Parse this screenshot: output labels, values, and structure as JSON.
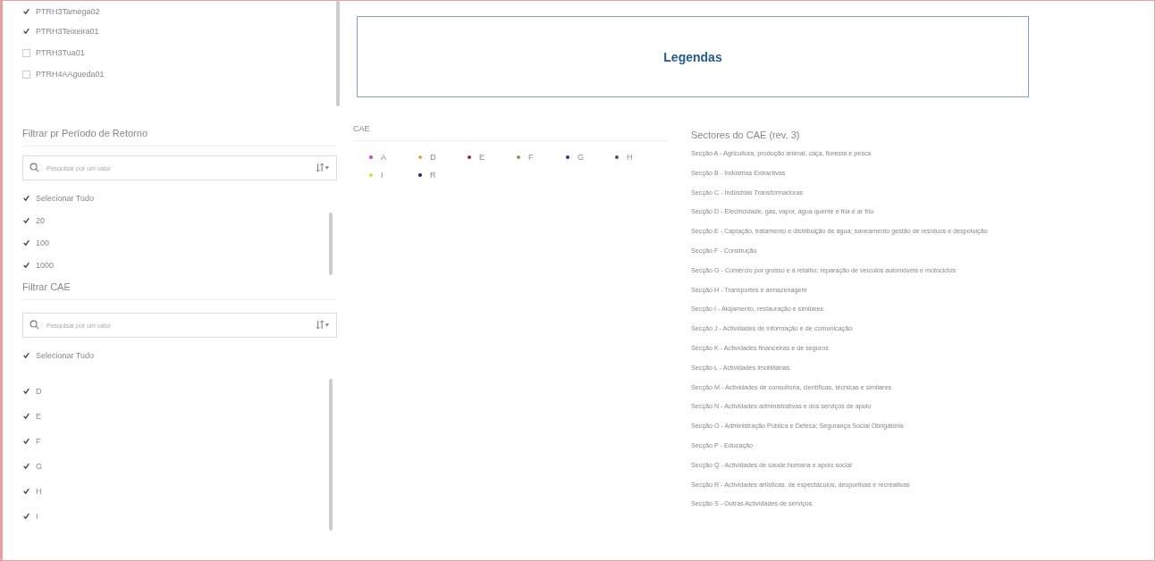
{
  "left_panel": {
    "top_list": [
      {
        "label": "PTRH3Tamega02",
        "checked": true
      },
      {
        "label": "PTRH3Teixeira01",
        "checked": true
      },
      {
        "label": "PTRH3Tua01",
        "checked": false
      },
      {
        "label": "PTRH4AAgueda01",
        "checked": false
      }
    ],
    "filters": [
      {
        "title": "Filtrar pr Período de Retorno",
        "search": {
          "placeholder": "Pesquisar por um valor"
        },
        "select_all": {
          "label": "Selecionar Tudo",
          "checked": true
        },
        "items": [
          {
            "label": "20",
            "checked": true
          },
          {
            "label": "100",
            "checked": true
          },
          {
            "label": "1000",
            "checked": true
          }
        ]
      },
      {
        "title": "Filtrar CAE",
        "search": {
          "placeholder": "Pesquisar por um valor"
        },
        "select_all": {
          "label": "Selecionar Tudo",
          "checked": true
        },
        "items": [
          {
            "label": "D",
            "checked": true
          },
          {
            "label": "E",
            "checked": true
          },
          {
            "label": "F",
            "checked": true
          },
          {
            "label": "G",
            "checked": true
          },
          {
            "label": "H",
            "checked": true
          },
          {
            "label": "I",
            "checked": true
          }
        ]
      }
    ]
  },
  "legend": {
    "title": "Legendas",
    "cae": {
      "title": "CAE",
      "entries": [
        {
          "label": "A",
          "color": "#c040c0"
        },
        {
          "label": "D",
          "color": "#e0a060"
        },
        {
          "label": "E",
          "color": "#803040"
        },
        {
          "label": "F",
          "color": "#909060"
        },
        {
          "label": "G",
          "color": "#303090"
        },
        {
          "label": "H",
          "color": "#505050"
        },
        {
          "label": "I",
          "color": "#d0e040"
        },
        {
          "label": "R",
          "color": "#202070"
        }
      ]
    },
    "sectors": {
      "title": "Sectores do CAE (rev. 3)",
      "lines": [
        "Secção A - Agricultura, produção animal, caça, floresta e pesca",
        "Secção B - Indústrias Extractivas",
        "Secção C - Indústrias Transformadoras",
        "Secção D - Electricidade, gás, vapor, água quente e fria e ar frio",
        "Secção E - Captação, tratamento e distribuição de água; saneamento gestão de resíduos e despoluição",
        "Secção F - Construção",
        "Secção G - Comércio por grosso e a retalho; reparação de veículos automóveis e motociclos",
        "Secção H - Transportes e armazenagem",
        "Secção I - Alojamento, restauração e similares",
        "Secção J - Actividades de informação e de comunicação",
        "Secção K - Actividades financeiras e de seguros",
        "Secção L - Actividades imobiliárias",
        "Secção M - Actividades de consultoria, científicas, técnicas e similares",
        "Secção N - Actividades administrativas e dos serviços de apoio",
        "Secção O - Administração Pública e Defesa; Segurança Social Obrigatória",
        "Secção P - Educação",
        "Secção Q - Actividades de saúde humana e apoio social",
        "Secção R - Actividades artísticas, de espectáculos, desportivas e recreativas",
        "Secção S - Outras Actividades de serviços"
      ]
    }
  }
}
